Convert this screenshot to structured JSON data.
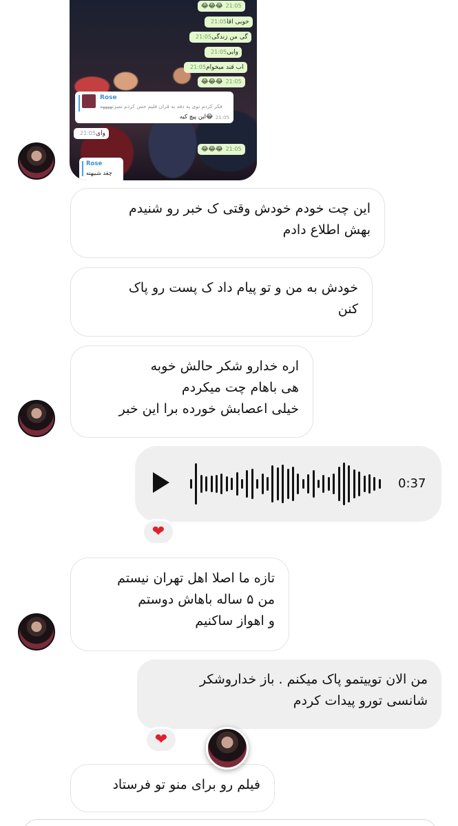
{
  "shared_screenshot": {
    "messages": [
      {
        "text": "😂😂😂",
        "time": "21:05"
      },
      {
        "text": "خوبی اقا",
        "time": "21:05"
      },
      {
        "text": "گی من زندگی",
        "time": "21:05"
      },
      {
        "text": "وایی",
        "time": "21:05"
      },
      {
        "text": "اب قند میخوام",
        "time": "21:05"
      },
      {
        "text": "😂😂😂",
        "time": "21:05"
      }
    ],
    "quote": {
      "name": "Rose",
      "text": "فکر کردم توی یه دفه به قران فلیم حس کردم تمیزتههههه",
      "reply": "این پیچ کیه😂",
      "time": "21:05"
    },
    "incoming": {
      "text": "وای",
      "time": "21:05"
    },
    "last_out": {
      "text": "😂😂😂",
      "time": "21:05"
    },
    "bottom_quote": {
      "name": "Rose",
      "text": "چقد شبیهته"
    }
  },
  "messages": [
    {
      "lines": [
        "این چت خودم خودش وقتی ک خبر رو شنیدم",
        "بهش اطلاع دادم"
      ]
    },
    {
      "lines": [
        "خودش به من و تو پیام داد ک پست رو پاک",
        "کنن"
      ]
    },
    {
      "lines": [
        "اره خدارو شکر حالش خوبه",
        "هی باهام چت میکردم",
        "خیلی اعصابش خورده برا این خبر"
      ]
    },
    {
      "lines": [
        "تازه ما اصلا اهل تهران نیستم",
        "من ۵ ساله باهاش دوستم",
        "و اهواز ساکنیم"
      ]
    },
    {
      "lines": [
        "من الان توییتمو پاک میکنم . باز خداروشکر",
        "شانسی تورو پیدات کردم"
      ]
    },
    {
      "lines": [
        "فیلم رو برای منو تو فرستاد"
      ]
    }
  ],
  "voice_message": {
    "duration": "0:37"
  },
  "reaction": "❤",
  "icons": {
    "play": "play-icon",
    "heart": "heart-reaction-icon"
  },
  "colors": {
    "incoming_bg": "#ffffff",
    "outgoing_bg": "#efefef",
    "heart": "#e0202c"
  }
}
